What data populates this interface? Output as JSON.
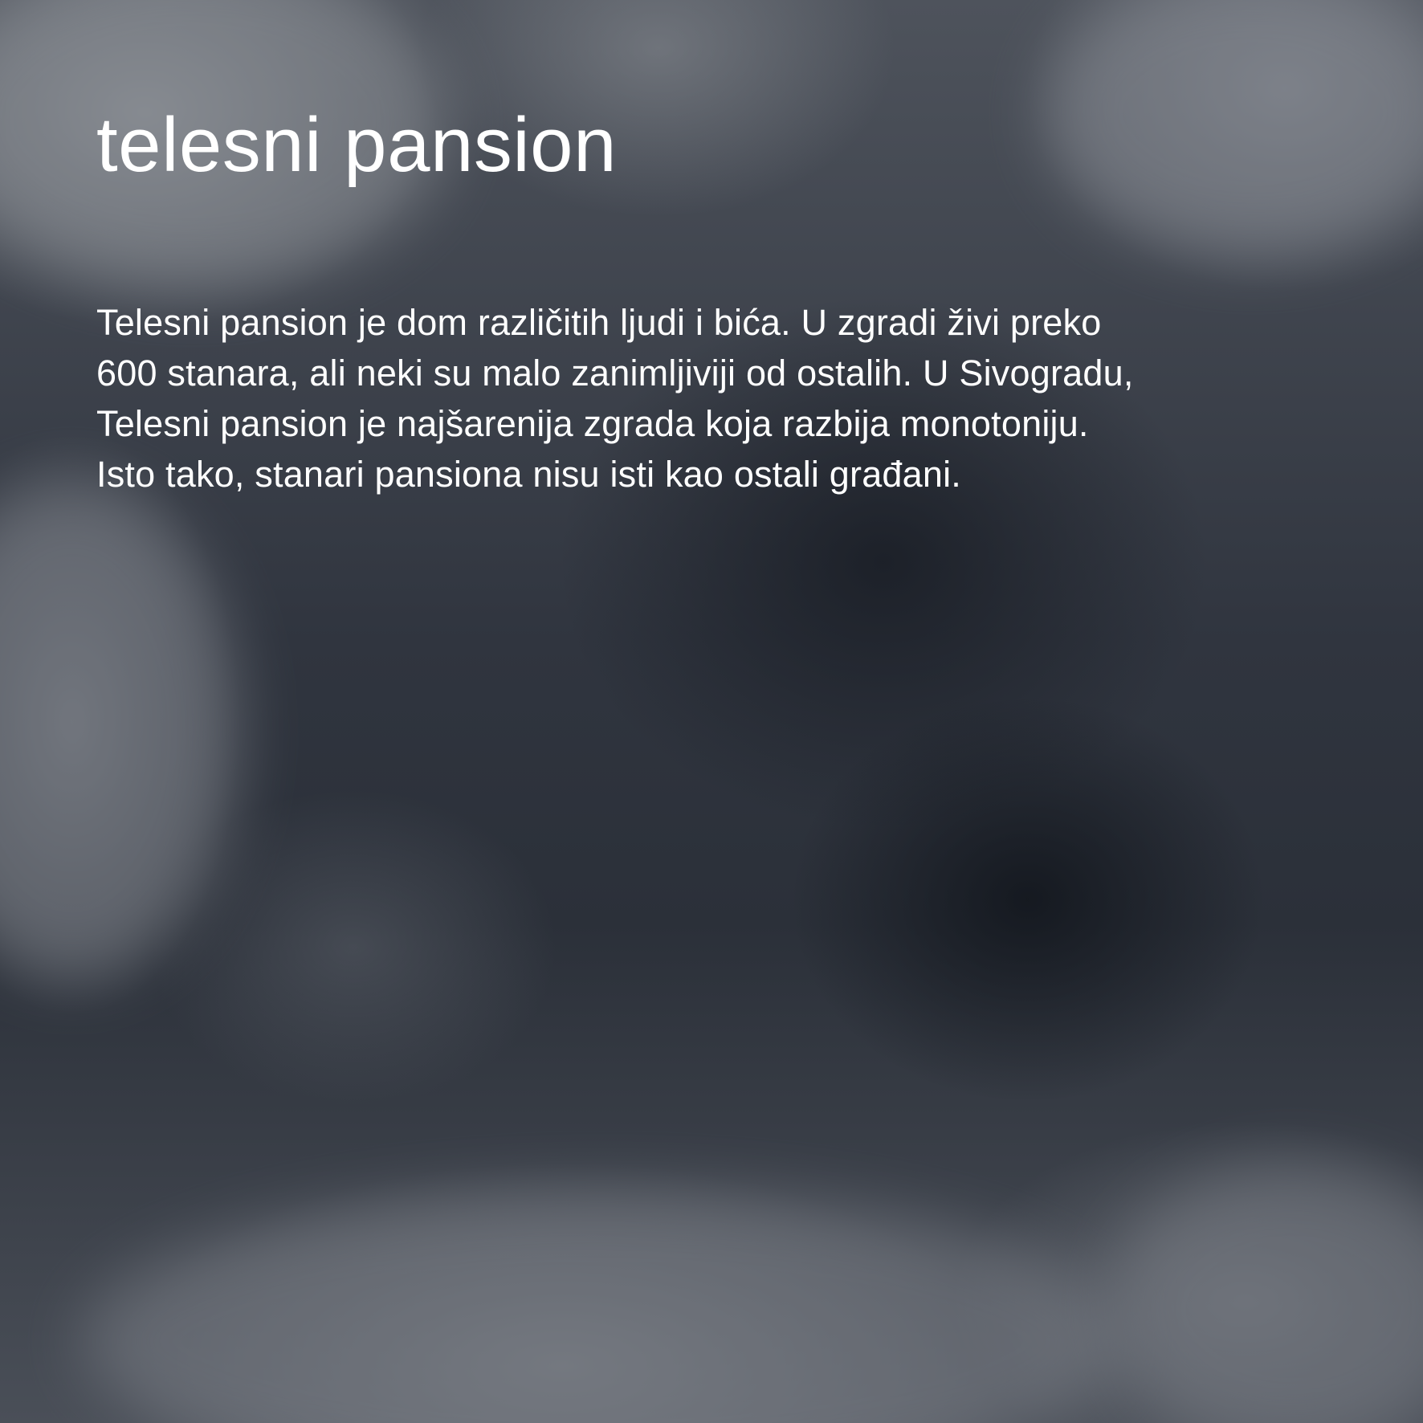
{
  "page": {
    "title": "telesni pansion",
    "paragraph_lines": [
      "Telesni pansion je dom različitih ljudi i bića. U zgradi živi preko",
      "600 stanara, ali neki su malo zanimljiviji od ostalih. U Sivogradu,",
      "Telesni pansion je najšarenija zgrada koja razbija monotoniju.",
      "Isto tako, stanari pansiona nisu isti kao ostali građani."
    ]
  },
  "colors": {
    "text": "#ffffff",
    "background_dark": "#1e222a",
    "cloud_light": "#8c9096"
  }
}
